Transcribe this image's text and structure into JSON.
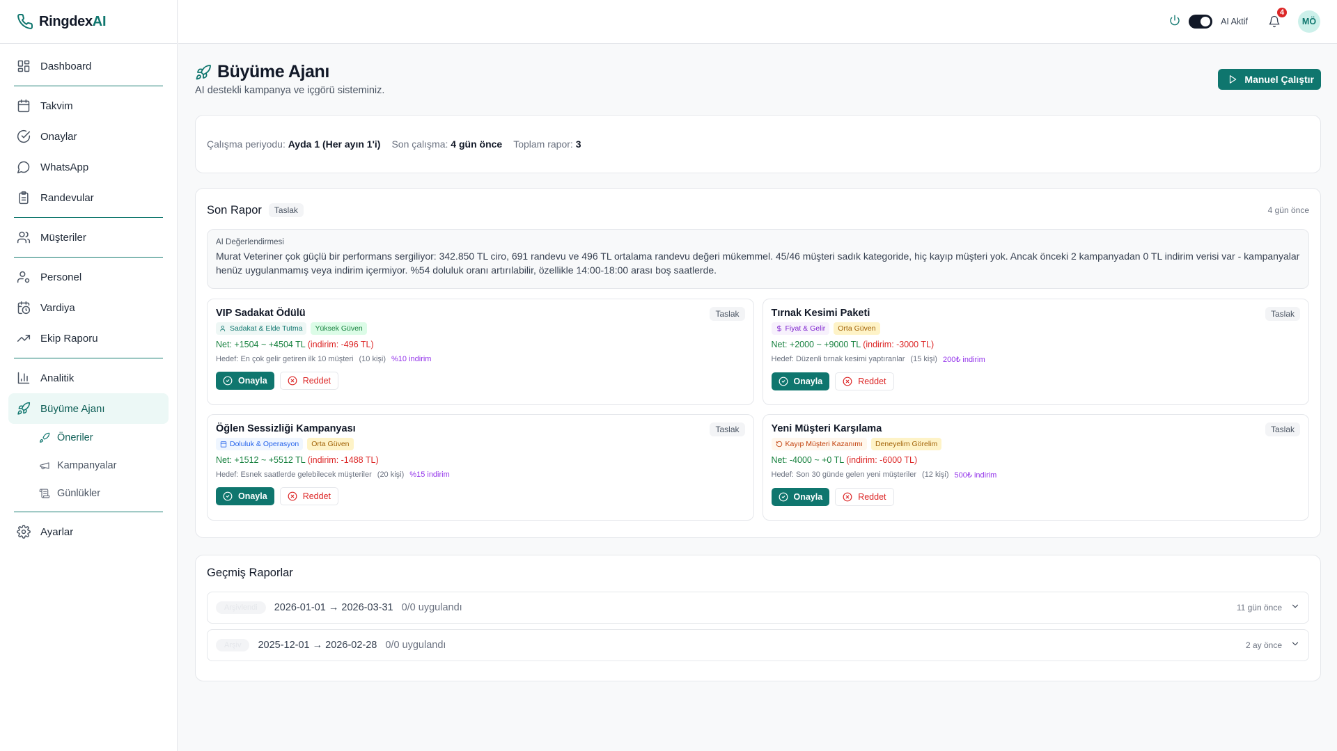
{
  "app": {
    "logo_main": "Ringdex",
    "logo_accent": "AI"
  },
  "sidebar": {
    "items": [
      {
        "label": "Dashboard"
      },
      {
        "label": "Takvim"
      },
      {
        "label": "Onaylar"
      },
      {
        "label": "WhatsApp"
      },
      {
        "label": "Randevular"
      },
      {
        "label": "Müşteriler"
      },
      {
        "label": "Personel"
      },
      {
        "label": "Vardiya"
      },
      {
        "label": "Ekip Raporu"
      },
      {
        "label": "Analitik"
      },
      {
        "label": "Büyüme Ajanı"
      },
      {
        "label": "Ayarlar"
      }
    ],
    "subitems": [
      {
        "label": "Öneriler"
      },
      {
        "label": "Kampanyalar"
      },
      {
        "label": "Günlükler"
      }
    ]
  },
  "topbar": {
    "ai_label": "AI Aktif",
    "notification_count": "4",
    "avatar_initials": "MÖ"
  },
  "page": {
    "title": "Büyüme Ajanı",
    "subtitle": "AI destekli kampanya ve içgörü sisteminiz.",
    "run_button": "Manuel Çalıştır"
  },
  "info": {
    "period_label": "Çalışma periyodu:",
    "period_value": "Ayda 1 (Her ayın 1'i)",
    "last_label": "Son çalışma:",
    "last_value": "4 gün önce",
    "total_label": "Toplam rapor:",
    "total_value": "3"
  },
  "report": {
    "title": "Son Rapor",
    "status": "Taslak",
    "time": "4 gün önce",
    "ai_label": "AI Değerlendirmesi",
    "ai_text": "Murat Veteriner çok güçlü bir performans sergiliyor: 342.850 TL ciro, 691 randevu ve 496 TL ortalama randevu değeri mükemmel. 45/46 müşteri sadık kategoride, hiç kayıp müşteri yok. Ancak önceki 2 kampanyadan 0 TL indirim verisi var - kampanyalar henüz uygulanmamış veya indirim içermiyor. %54 doluluk oranı artırılabilir, özellikle 14:00-18:00 arası boş saatlerde.",
    "campaigns": [
      {
        "title": "VIP Sadakat Ödülü",
        "status": "Taslak",
        "category": "Sadakat & Elde Tutma",
        "confidence": "Yüksek Güven",
        "net": "Net: +1504 ~ +4504 TL",
        "discount": "(indirim: -496 TL)",
        "target": "Hedef: En çok gelir getiren ilk 10 müşteri",
        "count": "(10 kişi)",
        "offer": "%10 indirim",
        "approve": "Onayla",
        "reject": "Reddet"
      },
      {
        "title": "Tırnak Kesimi Paketi",
        "status": "Taslak",
        "category": "Fiyat & Gelir",
        "confidence": "Orta Güven",
        "net": "Net: +2000 ~ +9000 TL",
        "discount": "(indirim: -3000 TL)",
        "target": "Hedef: Düzenli tırnak kesimi yaptıranlar",
        "count": "(15 kişi)",
        "offer": "200₺ indirim",
        "approve": "Onayla",
        "reject": "Reddet"
      },
      {
        "title": "Öğlen Sessizliği Kampanyası",
        "status": "Taslak",
        "category": "Doluluk & Operasyon",
        "confidence": "Orta Güven",
        "net": "Net: +1512 ~ +5512 TL",
        "discount": "(indirim: -1488 TL)",
        "target": "Hedef: Esnek saatlerde gelebilecek müşteriler",
        "count": "(20 kişi)",
        "offer": "%15 indirim",
        "approve": "Onayla",
        "reject": "Reddet"
      },
      {
        "title": "Yeni Müşteri Karşılama",
        "status": "Taslak",
        "category": "Kayıp Müşteri Kazanımı",
        "confidence": "Deneyelim Görelim",
        "net": "Net: -4000 ~ +0 TL",
        "discount": "(indirim: -6000 TL)",
        "target": "Hedef: Son 30 günde gelen yeni müşteriler",
        "count": "(12 kişi)",
        "offer": "500₺ indirim",
        "approve": "Onayla",
        "reject": "Reddet"
      }
    ]
  },
  "history": {
    "title": "Geçmiş Raporlar",
    "rows": [
      {
        "status": "Arşivlendi",
        "range": "2026-01-01 → 2026-03-31",
        "applied": "0/0 uygulandı",
        "time": "11 gün önce"
      },
      {
        "status": "Arşiv",
        "range": "2025-12-01 → 2026-02-28",
        "applied": "0/0 uygulandı",
        "time": "2 ay önce"
      }
    ]
  },
  "colors": {
    "brand": "#0f766e",
    "danger": "#dc2626",
    "positive": "#15803d",
    "offer": "#9333ea"
  }
}
